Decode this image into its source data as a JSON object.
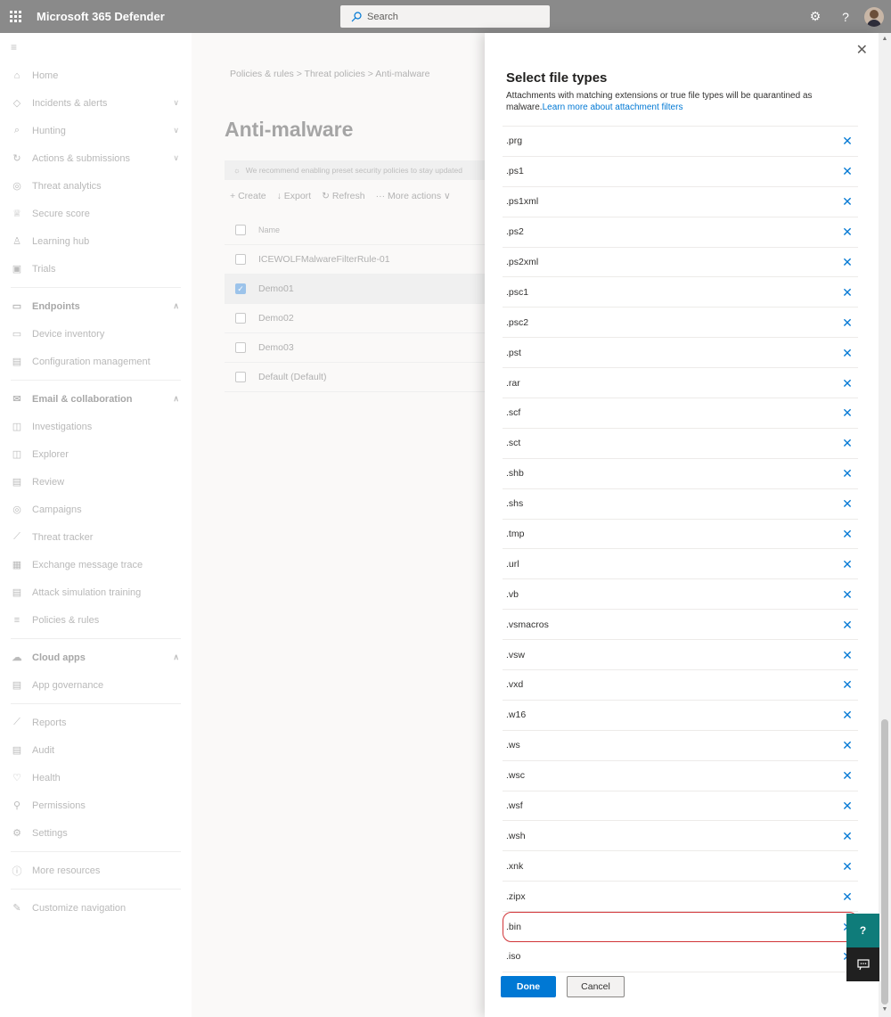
{
  "topbar": {
    "app_title": "Microsoft 365 Defender",
    "search_placeholder": "Search",
    "help_label": "?"
  },
  "nav": {
    "items": [
      {
        "label": "Home",
        "icon": "home-icon",
        "glyph": "⌂",
        "chevron": ""
      },
      {
        "label": "Incidents & alerts",
        "icon": "shield-icon",
        "glyph": "◇",
        "chevron": "∨"
      },
      {
        "label": "Hunting",
        "icon": "hunting-icon",
        "glyph": "⌕",
        "chevron": "∨"
      },
      {
        "label": "Actions & submissions",
        "icon": "actions-icon",
        "glyph": "↻",
        "chevron": "∨"
      },
      {
        "label": "Threat analytics",
        "icon": "analytics-icon",
        "glyph": "◎",
        "chevron": ""
      },
      {
        "label": "Secure score",
        "icon": "trophy-icon",
        "glyph": "♕",
        "chevron": ""
      },
      {
        "label": "Learning hub",
        "icon": "learning-icon",
        "glyph": "♙",
        "chevron": ""
      },
      {
        "label": "Trials",
        "icon": "gift-icon",
        "glyph": "▣",
        "chevron": ""
      }
    ],
    "endpoints": {
      "header": {
        "label": "Endpoints",
        "icon": "endpoints-icon",
        "glyph": "▭",
        "chevron": "∧"
      },
      "items": [
        {
          "label": "Device inventory",
          "icon": "device-icon",
          "glyph": "▭"
        },
        {
          "label": "Configuration management",
          "icon": "config-icon",
          "glyph": "▤"
        }
      ]
    },
    "email": {
      "header": {
        "label": "Email & collaboration",
        "icon": "mail-icon",
        "glyph": "✉",
        "chevron": "∧"
      },
      "items": [
        {
          "label": "Investigations",
          "icon": "investigations-icon",
          "glyph": "◫"
        },
        {
          "label": "Explorer",
          "icon": "explorer-icon",
          "glyph": "◫"
        },
        {
          "label": "Review",
          "icon": "review-icon",
          "glyph": "▤"
        },
        {
          "label": "Campaigns",
          "icon": "campaigns-icon",
          "glyph": "◎"
        },
        {
          "label": "Threat tracker",
          "icon": "tracker-icon",
          "glyph": "⟋"
        },
        {
          "label": "Exchange message trace",
          "icon": "exchange-icon",
          "glyph": "▦"
        },
        {
          "label": "Attack simulation training",
          "icon": "simulation-icon",
          "glyph": "▤"
        },
        {
          "label": "Policies & rules",
          "icon": "policies-icon",
          "glyph": "≡"
        }
      ]
    },
    "cloud": {
      "header": {
        "label": "Cloud apps",
        "icon": "cloud-icon",
        "glyph": "☁",
        "chevron": "∧"
      },
      "items": [
        {
          "label": "App governance",
          "icon": "app-governance-icon",
          "glyph": "▤"
        }
      ]
    },
    "bottom": [
      {
        "label": "Reports",
        "icon": "reports-icon",
        "glyph": "⟋"
      },
      {
        "label": "Audit",
        "icon": "audit-icon",
        "glyph": "▤"
      },
      {
        "label": "Health",
        "icon": "health-icon",
        "glyph": "♡"
      },
      {
        "label": "Permissions",
        "icon": "permissions-icon",
        "glyph": "⚲"
      },
      {
        "label": "Settings",
        "icon": "settings-icon",
        "glyph": "⚙"
      }
    ],
    "more": {
      "label": "More resources",
      "icon": "info-icon",
      "glyph": "ⓘ"
    },
    "customize": {
      "label": "Customize navigation",
      "icon": "pencil-icon",
      "glyph": "✎"
    }
  },
  "main": {
    "breadcrumb": "Policies & rules  >  Threat policies  >  Anti-malware",
    "title": "Anti-malware",
    "recommend": "We recommend enabling preset security policies to stay updated",
    "toolbar": {
      "create": "Create",
      "export": "Export",
      "refresh": "Refresh",
      "more": "More actions"
    },
    "table": {
      "header": "Name",
      "rows": [
        {
          "name": "ICEWOLFMalwareFilterRule-01",
          "checked": false
        },
        {
          "name": "Demo01",
          "checked": true
        },
        {
          "name": "Demo02",
          "checked": false
        },
        {
          "name": "Demo03",
          "checked": false
        },
        {
          "name": "Default (Default)",
          "checked": false
        }
      ]
    }
  },
  "panel": {
    "title": "Select file types",
    "description": "Attachments with matching extensions or true file types will be quarantined as malware.",
    "learn_more": "Learn more about attachment filters",
    "file_types": [
      ".prg",
      ".ps1",
      ".ps1xml",
      ".ps2",
      ".ps2xml",
      ".psc1",
      ".psc2",
      ".pst",
      ".rar",
      ".scf",
      ".sct",
      ".shb",
      ".shs",
      ".tmp",
      ".url",
      ".vb",
      ".vsmacros",
      ".vsw",
      ".vxd",
      ".w16",
      ".ws",
      ".wsc",
      ".wsf",
      ".wsh",
      ".xnk",
      ".zipx",
      ".bin",
      ".iso"
    ],
    "highlighted": ".bin",
    "done": "Done",
    "cancel": "Cancel"
  },
  "colors": {
    "accent": "#0078d4",
    "highlight_outline": "#d13438",
    "topbar": "#8a8a8a",
    "help_button": "#0f7c7a"
  }
}
